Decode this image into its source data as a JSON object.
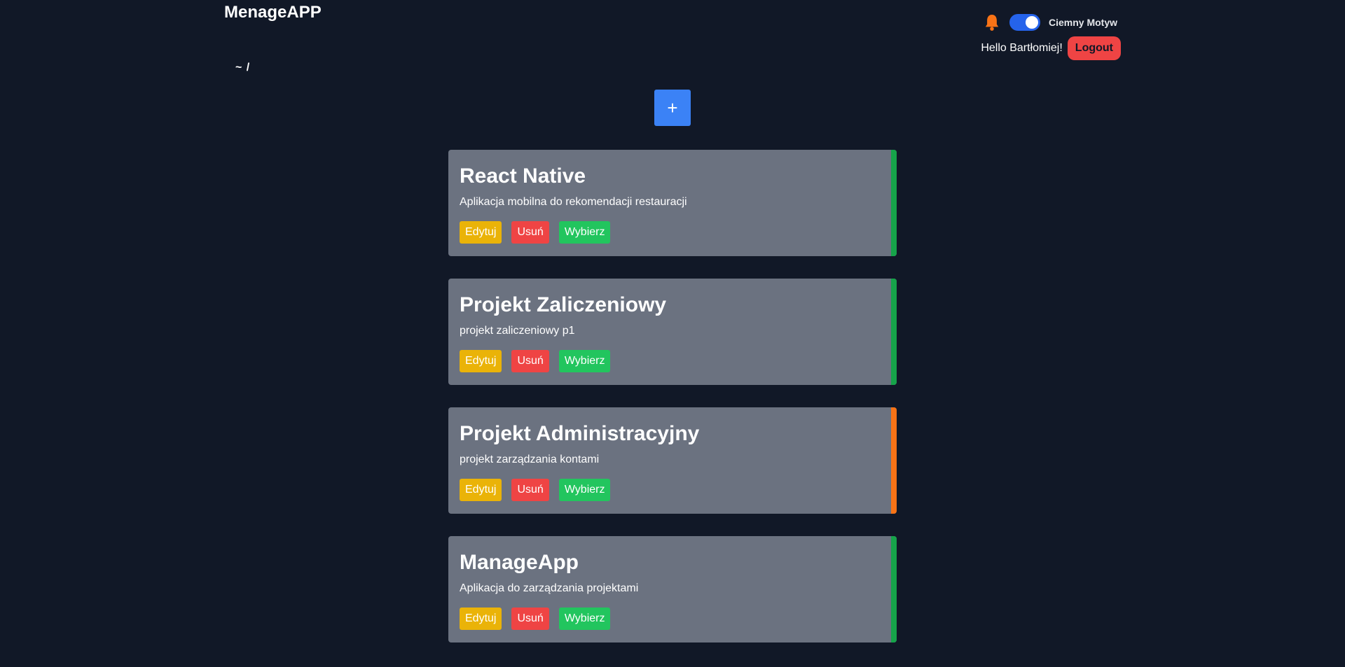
{
  "header": {
    "brand": "MenageAPP",
    "theme_label": "Ciemny Motyw",
    "greeting": "Hello Bartłomiej!",
    "logout_label": "Logout",
    "bell_color": "#f97316",
    "toggle_on": true
  },
  "breadcrumb": "~ /",
  "add_button_label": "+",
  "projects": [
    {
      "title": "React Native",
      "description": "Aplikacja mobilna do rekomendacji restauracji",
      "status_color": "#16a34a",
      "edit_label": "Edytuj",
      "delete_label": "Usuń",
      "select_label": "Wybierz"
    },
    {
      "title": "Projekt Zaliczeniowy",
      "description": "projekt zaliczeniowy p1",
      "status_color": "#16a34a",
      "edit_label": "Edytuj",
      "delete_label": "Usuń",
      "select_label": "Wybierz"
    },
    {
      "title": "Projekt Administracyjny",
      "description": "projekt zarządzania kontami",
      "status_color": "#f97316",
      "edit_label": "Edytuj",
      "delete_label": "Usuń",
      "select_label": "Wybierz"
    },
    {
      "title": "ManageApp",
      "description": "Aplikacja do zarządzania projektami",
      "status_color": "#16a34a",
      "edit_label": "Edytuj",
      "delete_label": "Usuń",
      "select_label": "Wybierz"
    }
  ],
  "colors": {
    "background": "#111827",
    "card": "#6b7280",
    "edit": "#eab308",
    "delete": "#ef4444",
    "select": "#22c55e",
    "add": "#3b82f6"
  }
}
